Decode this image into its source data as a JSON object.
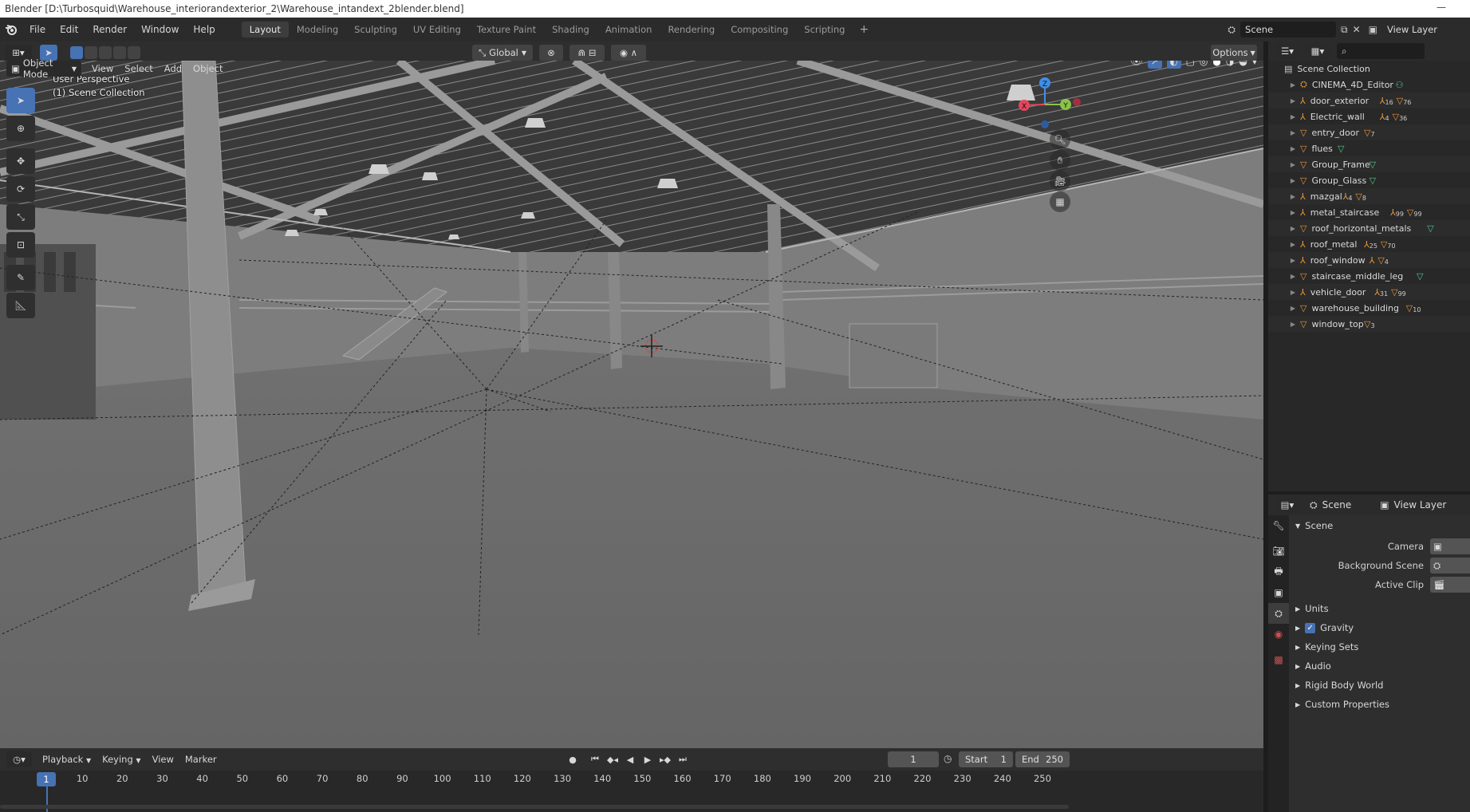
{
  "window_title": "Blender [D:\\Turbosquid\\Warehouse_interiorandexterior_2\\Warehouse_intandext_2blender.blend]",
  "menu": [
    "File",
    "Edit",
    "Render",
    "Window",
    "Help"
  ],
  "workspaces": [
    "Layout",
    "Modeling",
    "Sculpting",
    "UV Editing",
    "Texture Paint",
    "Shading",
    "Animation",
    "Rendering",
    "Compositing",
    "Scripting"
  ],
  "active_workspace": "Layout",
  "scene_name": "Scene",
  "view_layer_name": "View Layer",
  "viewport": {
    "mode": "Object Mode",
    "menus": [
      "View",
      "Select",
      "Add",
      "Object"
    ],
    "orientation": "Global",
    "options_label": "Options",
    "perspective_label": "User Perspective",
    "collection_label": "(1) Scene Collection",
    "gizmo_axes": {
      "x": "X",
      "y": "Y",
      "z": "Z"
    }
  },
  "outliner": {
    "root": "Scene Collection",
    "items": [
      {
        "name": "CINEMA_4D_Editor",
        "badges": [
          {
            "icon": "light-icon",
            "count": ""
          }
        ]
      },
      {
        "name": "door_exterior",
        "badges": [
          {
            "icon": "empty-icon",
            "count": "16"
          },
          {
            "icon": "mesh-icon",
            "count": "76"
          }
        ]
      },
      {
        "name": "Electric_wall",
        "badges": [
          {
            "icon": "empty-icon",
            "count": "4"
          },
          {
            "icon": "mesh-icon",
            "count": "36"
          }
        ]
      },
      {
        "name": "entry_door",
        "badges": [
          {
            "icon": "mesh-icon",
            "count": "7"
          }
        ]
      },
      {
        "name": "flues",
        "badges": [
          {
            "icon": "mesh-data-icon",
            "count": ""
          }
        ]
      },
      {
        "name": "Group_Frame",
        "badges": [
          {
            "icon": "mesh-data-icon",
            "count": ""
          }
        ]
      },
      {
        "name": "Group_Glass",
        "badges": [
          {
            "icon": "mesh-data-icon",
            "count": ""
          }
        ]
      },
      {
        "name": "mazgal",
        "badges": [
          {
            "icon": "empty-icon",
            "count": "4"
          },
          {
            "icon": "mesh-icon",
            "count": "8"
          }
        ]
      },
      {
        "name": "metal_staircase",
        "badges": [
          {
            "icon": "empty-icon",
            "count": "99"
          },
          {
            "icon": "mesh-icon",
            "count": "99"
          }
        ]
      },
      {
        "name": "roof_horizontal_metals",
        "badges": [
          {
            "icon": "mesh-data-icon",
            "count": ""
          }
        ]
      },
      {
        "name": "roof_metal",
        "badges": [
          {
            "icon": "empty-icon",
            "count": "25"
          },
          {
            "icon": "mesh-icon",
            "count": "70"
          }
        ]
      },
      {
        "name": "roof_window",
        "badges": [
          {
            "icon": "empty-icon",
            "count": ""
          },
          {
            "icon": "mesh-icon",
            "count": "4"
          }
        ]
      },
      {
        "name": "staircase_middle_leg",
        "badges": [
          {
            "icon": "mesh-data-icon",
            "count": ""
          }
        ]
      },
      {
        "name": "vehicle_door",
        "badges": [
          {
            "icon": "empty-icon",
            "count": "31"
          },
          {
            "icon": "mesh-icon",
            "count": "99"
          }
        ]
      },
      {
        "name": "warehouse_building",
        "badges": [
          {
            "icon": "mesh-icon",
            "count": "10"
          }
        ]
      },
      {
        "name": "window_top",
        "badges": [
          {
            "icon": "mesh-icon",
            "count": "3"
          }
        ]
      }
    ]
  },
  "properties": {
    "header_scene": "Scene",
    "header_view_layer": "View Layer",
    "panel_title": "Scene",
    "fields": [
      {
        "label": "Camera"
      },
      {
        "label": "Background Scene"
      },
      {
        "label": "Active Clip"
      }
    ],
    "subpanels": [
      "Units",
      "Gravity",
      "Keying Sets",
      "Audio",
      "Rigid Body World",
      "Custom Properties"
    ],
    "gravity_checked": true
  },
  "timeline": {
    "menus": [
      "Playback",
      "Keying",
      "View",
      "Marker"
    ],
    "current_frame": "1",
    "start_label": "Start",
    "start_value": "1",
    "end_label": "End",
    "end_value": "250",
    "ticks": [
      "1",
      "10",
      "20",
      "30",
      "40",
      "50",
      "60",
      "70",
      "80",
      "90",
      "100",
      "110",
      "120",
      "130",
      "140",
      "150",
      "160",
      "170",
      "180",
      "190",
      "200",
      "210",
      "220",
      "230",
      "240",
      "250"
    ]
  },
  "colors": {
    "accent": "#4772b3",
    "orange_icon": "#e8953a",
    "green_icon": "#52c68b",
    "axis_x": "#e3475c",
    "axis_y": "#8bc34a",
    "axis_z": "#3f8ee8"
  }
}
